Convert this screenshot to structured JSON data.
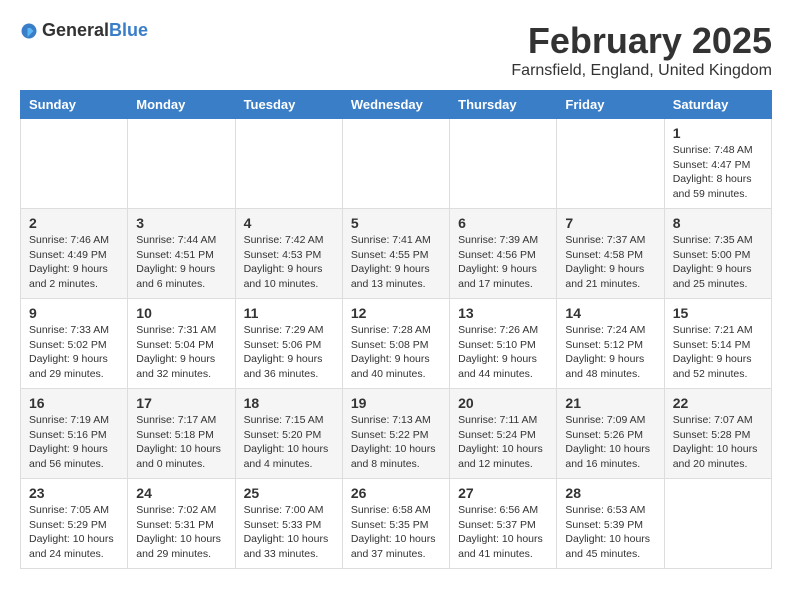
{
  "header": {
    "logo_general": "General",
    "logo_blue": "Blue",
    "title": "February 2025",
    "subtitle": "Farnsfield, England, United Kingdom"
  },
  "weekdays": [
    "Sunday",
    "Monday",
    "Tuesday",
    "Wednesday",
    "Thursday",
    "Friday",
    "Saturday"
  ],
  "weeks": [
    [
      {
        "day": "",
        "info": ""
      },
      {
        "day": "",
        "info": ""
      },
      {
        "day": "",
        "info": ""
      },
      {
        "day": "",
        "info": ""
      },
      {
        "day": "",
        "info": ""
      },
      {
        "day": "",
        "info": ""
      },
      {
        "day": "1",
        "info": "Sunrise: 7:48 AM\nSunset: 4:47 PM\nDaylight: 8 hours and 59 minutes."
      }
    ],
    [
      {
        "day": "2",
        "info": "Sunrise: 7:46 AM\nSunset: 4:49 PM\nDaylight: 9 hours and 2 minutes."
      },
      {
        "day": "3",
        "info": "Sunrise: 7:44 AM\nSunset: 4:51 PM\nDaylight: 9 hours and 6 minutes."
      },
      {
        "day": "4",
        "info": "Sunrise: 7:42 AM\nSunset: 4:53 PM\nDaylight: 9 hours and 10 minutes."
      },
      {
        "day": "5",
        "info": "Sunrise: 7:41 AM\nSunset: 4:55 PM\nDaylight: 9 hours and 13 minutes."
      },
      {
        "day": "6",
        "info": "Sunrise: 7:39 AM\nSunset: 4:56 PM\nDaylight: 9 hours and 17 minutes."
      },
      {
        "day": "7",
        "info": "Sunrise: 7:37 AM\nSunset: 4:58 PM\nDaylight: 9 hours and 21 minutes."
      },
      {
        "day": "8",
        "info": "Sunrise: 7:35 AM\nSunset: 5:00 PM\nDaylight: 9 hours and 25 minutes."
      }
    ],
    [
      {
        "day": "9",
        "info": "Sunrise: 7:33 AM\nSunset: 5:02 PM\nDaylight: 9 hours and 29 minutes."
      },
      {
        "day": "10",
        "info": "Sunrise: 7:31 AM\nSunset: 5:04 PM\nDaylight: 9 hours and 32 minutes."
      },
      {
        "day": "11",
        "info": "Sunrise: 7:29 AM\nSunset: 5:06 PM\nDaylight: 9 hours and 36 minutes."
      },
      {
        "day": "12",
        "info": "Sunrise: 7:28 AM\nSunset: 5:08 PM\nDaylight: 9 hours and 40 minutes."
      },
      {
        "day": "13",
        "info": "Sunrise: 7:26 AM\nSunset: 5:10 PM\nDaylight: 9 hours and 44 minutes."
      },
      {
        "day": "14",
        "info": "Sunrise: 7:24 AM\nSunset: 5:12 PM\nDaylight: 9 hours and 48 minutes."
      },
      {
        "day": "15",
        "info": "Sunrise: 7:21 AM\nSunset: 5:14 PM\nDaylight: 9 hours and 52 minutes."
      }
    ],
    [
      {
        "day": "16",
        "info": "Sunrise: 7:19 AM\nSunset: 5:16 PM\nDaylight: 9 hours and 56 minutes."
      },
      {
        "day": "17",
        "info": "Sunrise: 7:17 AM\nSunset: 5:18 PM\nDaylight: 10 hours and 0 minutes."
      },
      {
        "day": "18",
        "info": "Sunrise: 7:15 AM\nSunset: 5:20 PM\nDaylight: 10 hours and 4 minutes."
      },
      {
        "day": "19",
        "info": "Sunrise: 7:13 AM\nSunset: 5:22 PM\nDaylight: 10 hours and 8 minutes."
      },
      {
        "day": "20",
        "info": "Sunrise: 7:11 AM\nSunset: 5:24 PM\nDaylight: 10 hours and 12 minutes."
      },
      {
        "day": "21",
        "info": "Sunrise: 7:09 AM\nSunset: 5:26 PM\nDaylight: 10 hours and 16 minutes."
      },
      {
        "day": "22",
        "info": "Sunrise: 7:07 AM\nSunset: 5:28 PM\nDaylight: 10 hours and 20 minutes."
      }
    ],
    [
      {
        "day": "23",
        "info": "Sunrise: 7:05 AM\nSunset: 5:29 PM\nDaylight: 10 hours and 24 minutes."
      },
      {
        "day": "24",
        "info": "Sunrise: 7:02 AM\nSunset: 5:31 PM\nDaylight: 10 hours and 29 minutes."
      },
      {
        "day": "25",
        "info": "Sunrise: 7:00 AM\nSunset: 5:33 PM\nDaylight: 10 hours and 33 minutes."
      },
      {
        "day": "26",
        "info": "Sunrise: 6:58 AM\nSunset: 5:35 PM\nDaylight: 10 hours and 37 minutes."
      },
      {
        "day": "27",
        "info": "Sunrise: 6:56 AM\nSunset: 5:37 PM\nDaylight: 10 hours and 41 minutes."
      },
      {
        "day": "28",
        "info": "Sunrise: 6:53 AM\nSunset: 5:39 PM\nDaylight: 10 hours and 45 minutes."
      },
      {
        "day": "",
        "info": ""
      }
    ]
  ]
}
